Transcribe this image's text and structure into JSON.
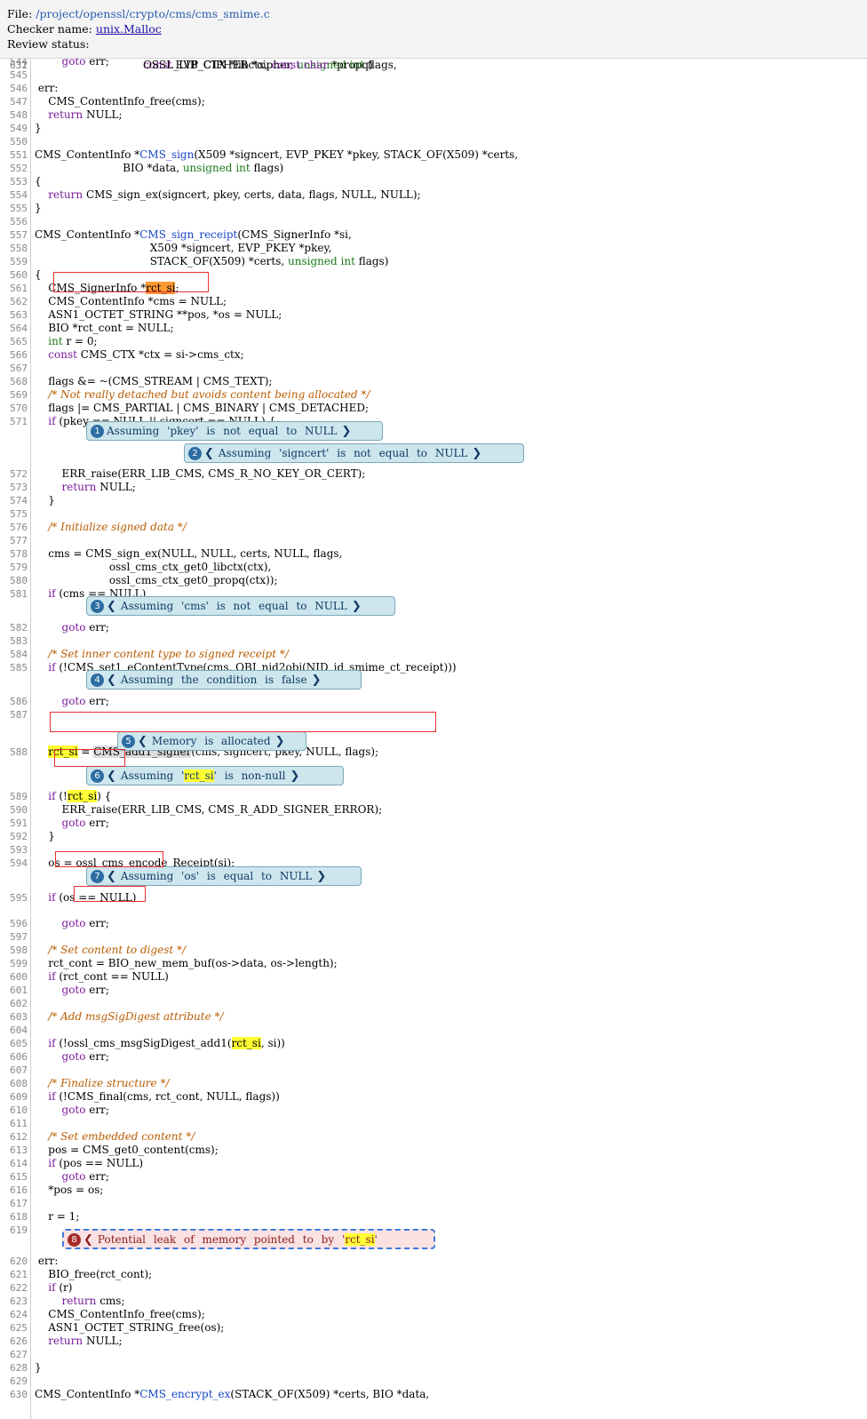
{
  "header": {
    "file_label": "File:",
    "file_path": "/project/openssl/crypto/cms/cms_smime.c",
    "checker_label": "Checker name:",
    "checker_name": "unix.Malloc",
    "review_label": "Review status:"
  },
  "code_lines": [
    {
      "n": "544",
      "t": "        goto err;"
    },
    {
      "n": "545",
      "t": ""
    },
    {
      "n": "546",
      "t": " err:"
    },
    {
      "n": "547",
      "t": "    CMS_ContentInfo_free(cms);"
    },
    {
      "n": "548",
      "t": "    return NULL;"
    },
    {
      "n": "549",
      "t": "}"
    },
    {
      "n": "550",
      "t": ""
    },
    {
      "n": "551",
      "t": "CMS_ContentInfo *CMS_sign(X509 *signcert, EVP_PKEY *pkey, STACK_OF(X509) *certs,"
    },
    {
      "n": "552",
      "t": "                          BIO *data, unsigned int flags)"
    },
    {
      "n": "553",
      "t": "{"
    },
    {
      "n": "554",
      "t": "    return CMS_sign_ex(signcert, pkey, certs, data, flags, NULL, NULL);"
    },
    {
      "n": "555",
      "t": "}"
    },
    {
      "n": "556",
      "t": ""
    },
    {
      "n": "557",
      "t": "CMS_ContentInfo *CMS_sign_receipt(CMS_SignerInfo *si,"
    },
    {
      "n": "558",
      "t": "                                  X509 *signcert, EVP_PKEY *pkey,"
    },
    {
      "n": "559",
      "t": "                                  STACK_OF(X509) *certs, unsigned int flags)"
    },
    {
      "n": "560",
      "t": "{"
    },
    {
      "n": "561",
      "t": "    CMS_SignerInfo *rct_si;"
    },
    {
      "n": "562",
      "t": "    CMS_ContentInfo *cms = NULL;"
    },
    {
      "n": "563",
      "t": "    ASN1_OCTET_STRING **pos, *os = NULL;"
    },
    {
      "n": "564",
      "t": "    BIO *rct_cont = NULL;"
    },
    {
      "n": "565",
      "t": "    int r = 0;"
    },
    {
      "n": "566",
      "t": "    const CMS_CTX *ctx = si->cms_ctx;"
    },
    {
      "n": "567",
      "t": ""
    },
    {
      "n": "568",
      "t": "    flags &= ~(CMS_STREAM | CMS_TEXT);"
    },
    {
      "n": "569",
      "t": "    /* Not really detached but avoids content being allocated */"
    },
    {
      "n": "570",
      "t": "    flags |= CMS_PARTIAL | CMS_BINARY | CMS_DETACHED;"
    },
    {
      "n": "571",
      "t": "    if (pkey == NULL || signcert == NULL) {"
    },
    {
      "n": "572",
      "t": "        ERR_raise(ERR_LIB_CMS, CMS_R_NO_KEY_OR_CERT);"
    },
    {
      "n": "573",
      "t": "        return NULL;"
    },
    {
      "n": "574",
      "t": "    }"
    },
    {
      "n": "575",
      "t": ""
    },
    {
      "n": "576",
      "t": "    /* Initialize signed data */"
    },
    {
      "n": "577",
      "t": ""
    },
    {
      "n": "578",
      "t": "    cms = CMS_sign_ex(NULL, NULL, certs, NULL, flags,"
    },
    {
      "n": "579",
      "t": "                      ossl_cms_ctx_get0_libctx(ctx),"
    },
    {
      "n": "580",
      "t": "                      ossl_cms_ctx_get0_propq(ctx));"
    },
    {
      "n": "581",
      "t": "    if (cms == NULL)"
    },
    {
      "n": "582",
      "t": "        goto err;"
    },
    {
      "n": "583",
      "t": ""
    },
    {
      "n": "584",
      "t": "    /* Set inner content type to signed receipt */"
    },
    {
      "n": "585",
      "t": "    if (!CMS_set1_eContentType(cms, OBJ_nid2obj(NID_id_smime_ct_receipt)))"
    },
    {
      "n": "586",
      "t": "        goto err;"
    },
    {
      "n": "587",
      "t": ""
    },
    {
      "n": "588",
      "t": "    rct_si = CMS_add1_signer(cms, signcert, pkey, NULL, flags);"
    },
    {
      "n": "589",
      "t": "    if (!rct_si) {"
    },
    {
      "n": "590",
      "t": "        ERR_raise(ERR_LIB_CMS, CMS_R_ADD_SIGNER_ERROR);"
    },
    {
      "n": "591",
      "t": "        goto err;"
    },
    {
      "n": "592",
      "t": "    }"
    },
    {
      "n": "593",
      "t": ""
    },
    {
      "n": "594",
      "t": "    os = ossl_cms_encode_Receipt(si);"
    },
    {
      "n": "595",
      "t": "    if (os == NULL)"
    },
    {
      "n": "596",
      "t": "        goto err;"
    },
    {
      "n": "597",
      "t": ""
    },
    {
      "n": "598",
      "t": "    /* Set content to digest */"
    },
    {
      "n": "599",
      "t": "    rct_cont = BIO_new_mem_buf(os->data, os->length);"
    },
    {
      "n": "600",
      "t": "    if (rct_cont == NULL)"
    },
    {
      "n": "601",
      "t": "        goto err;"
    },
    {
      "n": "602",
      "t": ""
    },
    {
      "n": "603",
      "t": "    /* Add msgSigDigest attribute */"
    },
    {
      "n": "604",
      "t": ""
    },
    {
      "n": "605",
      "t": "    if (!ossl_cms_msgSigDigest_add1(rct_si, si))"
    },
    {
      "n": "606",
      "t": "        goto err;"
    },
    {
      "n": "607",
      "t": ""
    },
    {
      "n": "608",
      "t": "    /* Finalize structure */"
    },
    {
      "n": "609",
      "t": "    if (!CMS_final(cms, rct_cont, NULL, flags))"
    },
    {
      "n": "610",
      "t": "        goto err;"
    },
    {
      "n": "611",
      "t": ""
    },
    {
      "n": "612",
      "t": "    /* Set embedded content */"
    },
    {
      "n": "613",
      "t": "    pos = CMS_get0_content(cms);"
    },
    {
      "n": "614",
      "t": "    if (pos == NULL)"
    },
    {
      "n": "615",
      "t": "        goto err;"
    },
    {
      "n": "616",
      "t": "    *pos = os;"
    },
    {
      "n": "617",
      "t": ""
    },
    {
      "n": "618",
      "t": "    r = 1;"
    },
    {
      "n": "619",
      "t": ""
    },
    {
      "n": "620",
      "t": " err:"
    },
    {
      "n": "621",
      "t": "    BIO_free(rct_cont);"
    },
    {
      "n": "622",
      "t": "    if (r)"
    },
    {
      "n": "623",
      "t": "        return cms;"
    },
    {
      "n": "624",
      "t": "    CMS_ContentInfo_free(cms);"
    },
    {
      "n": "625",
      "t": "    ASN1_OCTET_STRING_free(os);"
    },
    {
      "n": "626",
      "t": "    return NULL;"
    },
    {
      "n": "627",
      "t": ""
    },
    {
      "n": "628",
      "t": "}"
    },
    {
      "n": "629",
      "t": ""
    },
    {
      "n": "630",
      "t": "CMS_ContentInfo *CMS_encrypt_ex(STACK_OF(X509) *certs, BIO *data,"
    },
    {
      "n": "631",
      "t": "                                const EVP_CIPHER *cipher, unsigned int flags,"
    },
    {
      "n": "632",
      "t": "                                OSSL_LIB_CTX *libctx, const char *propq)"
    }
  ],
  "notes": [
    {
      "num": "1",
      "text": "Assuming 'pkey' is not equal to NULL",
      "prev": false,
      "next": true,
      "kind": "event"
    },
    {
      "num": "2",
      "text": "Assuming 'signcert' is not equal to NULL",
      "prev": true,
      "next": true,
      "kind": "event"
    },
    {
      "num": "3",
      "text": "Assuming 'cms' is not equal to NULL",
      "prev": true,
      "next": true,
      "kind": "event"
    },
    {
      "num": "4",
      "text": "Assuming the condition is false",
      "prev": true,
      "next": true,
      "kind": "event"
    },
    {
      "num": "5",
      "text": "Memory is allocated",
      "prev": true,
      "next": true,
      "kind": "event"
    },
    {
      "num": "6",
      "text": "Assuming 'rct_si' is non-null",
      "prev": true,
      "next": true,
      "kind": "event",
      "hl": "rct_si"
    },
    {
      "num": "7",
      "text": "Assuming 'os' is equal to NULL",
      "prev": true,
      "next": true,
      "kind": "event"
    },
    {
      "num": "8",
      "text": "Potential leak of memory pointed to by 'rct_si'",
      "prev": true,
      "next": false,
      "kind": "error",
      "hl": "rct_si"
    }
  ],
  "colors": {
    "keyword": "#7a1c9c",
    "type": "#1a7a1a",
    "function": "#1846c8",
    "comment": "#b85c00",
    "highlight": "#ffff33",
    "event_bubble": "#cde6ee",
    "error_bubble": "#fbe2e2",
    "box": "#e63030"
  },
  "icons": {
    "prev": "chevron-left-icon",
    "next": "chevron-right-icon"
  }
}
